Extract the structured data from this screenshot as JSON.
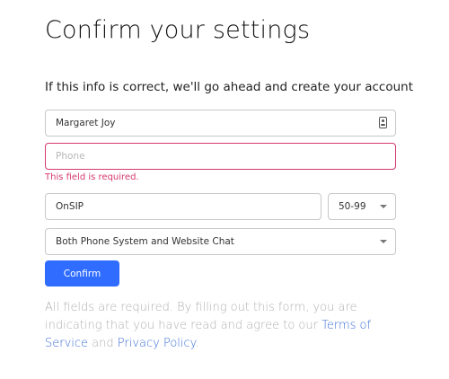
{
  "heading": "Confirm your settings",
  "subheading": "If this info is correct, we'll go ahead and create your account",
  "name_field": {
    "value": "Margaret Joy",
    "icon": "contact-card-icon"
  },
  "phone_field": {
    "value": "",
    "placeholder": "Phone",
    "error": "This field is required."
  },
  "company_field": {
    "value": "OnSIP"
  },
  "size_select": {
    "value": "50-99"
  },
  "product_select": {
    "value": "Both Phone System and Website Chat"
  },
  "confirm_button": {
    "label": "Confirm"
  },
  "disclaimer": {
    "text_before": "All fields are required. By filling out this form, you are indicating that you have read and agree to our ",
    "terms_link": "Terms of Service",
    "text_middle": " and ",
    "privacy_link": "Privacy Policy",
    "text_after": "."
  },
  "colors": {
    "accent": "#2f6cff",
    "error": "#d63a6e",
    "link": "#3a6ed8",
    "muted_text": "#b0b0b0"
  }
}
